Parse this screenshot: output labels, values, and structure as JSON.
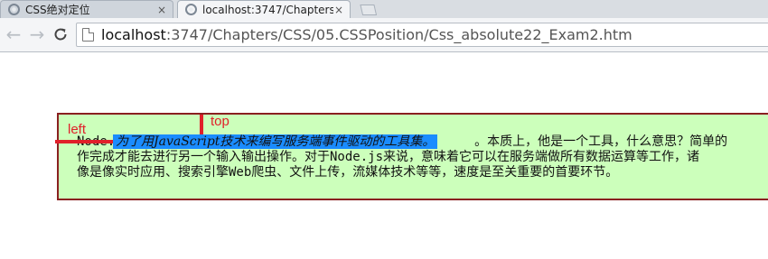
{
  "tabs": [
    {
      "title": "CSS绝对定位",
      "close": "×"
    },
    {
      "title": "localhost:3747/Chapters/",
      "close": "×"
    }
  ],
  "toolbar": {
    "back": "←",
    "forward": "→",
    "reload": "C"
  },
  "omnibox": {
    "host": "localhost",
    "path": ":3747/Chapters/CSS/05.CSSPosition/Css_absolute22_Exam2.htm"
  },
  "page": {
    "line1_prefix": "Node.",
    "line1_suffix": "。本质上，他是一个工具，什么意思？简单的",
    "line2": "作完成才能去进行另一个输入输出操作。对于Node.js来说，意味着它可以在服务端做所有数据运算等工作，诸",
    "line3": "像是像实时应用、搜索引擎Web爬虫、文件上传，流媒体技术等等，速度是至关重要的首要环节。",
    "highlight": "为了用JavaScript技术来编写服务端事件驱动的工具集。",
    "label_top": "top",
    "label_left": "left"
  },
  "colors": {
    "box_background": "#ccffbb",
    "box_border": "#8a2020",
    "highlight": "#1a8cff",
    "marker": "#e0202a"
  }
}
